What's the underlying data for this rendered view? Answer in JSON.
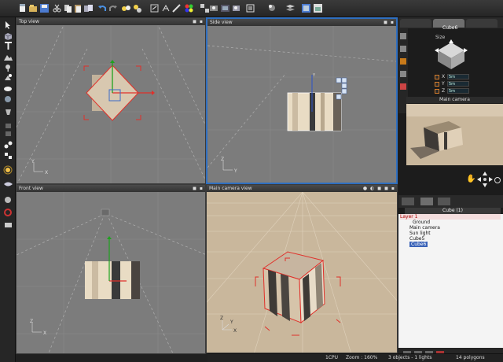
{
  "viewports": {
    "top": {
      "title": "Top view"
    },
    "side": {
      "title": "Side view"
    },
    "front": {
      "title": "Front view"
    },
    "camera": {
      "title": "Main camera view"
    }
  },
  "right_panel": {
    "object_name": "Cube6",
    "size_label": "Size",
    "x_label": "X",
    "y_label": "Y",
    "z_label": "Z",
    "x_value": "5m",
    "y_value": "5m",
    "z_value": "5m",
    "main_camera_label": "Main camera"
  },
  "scene_tree": {
    "header": "Cube (1)",
    "layer": "Layer 1",
    "items": [
      "Ground",
      "Main camera",
      "Sun light",
      "Cube5",
      "Cube6"
    ]
  },
  "status": {
    "cpu": "1CPU",
    "zoom": "Zoom : 160%",
    "objects": "3 objects - 1 lights",
    "polygons": "14 polygons"
  },
  "colors": {
    "accent": "#2f6fc0",
    "viewport_bg": "#7c7c7c",
    "selection": "#3a63b8",
    "ground": "#c9b79c"
  },
  "icons": {
    "axes": [
      "x-axis-icon",
      "y-axis-icon",
      "z-axis-icon"
    ]
  }
}
